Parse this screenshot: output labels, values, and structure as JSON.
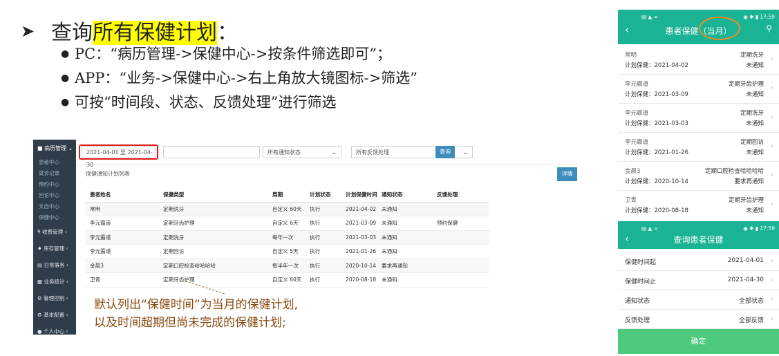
{
  "slide": {
    "heading_prefix": "查询",
    "heading_highlight": "所有保健计划",
    "heading_suffix": "：",
    "bullets": [
      "PC：“病历管理->保健中心->按条件筛选即可”；",
      "APP：“业务->保健中心->右上角放大镜图标->筛选”",
      "可按“时间段、状态、反馈处理”进行筛选"
    ],
    "note_lines": [
      "默认列出“保健时间”为当月的保健计划,",
      "以及时间超期但尚未完成的保健计划;"
    ],
    "highlight_color": "#ffff00"
  },
  "desktop": {
    "sidebar": {
      "top": "病历管理",
      "subitems": [
        "患者中心",
        "就诊记录",
        "预约中心",
        "回访中心",
        "文齿中心",
        "保健中心"
      ],
      "menus": [
        "收费管理",
        "库存管理",
        "日常事务",
        "业务统计",
        "管理控制",
        "基本配置",
        "个人中心"
      ]
    },
    "filters": {
      "date_range": "2021-04-01 至 2021-04-30",
      "notify_status": "所有通知状态",
      "feedback": "所有反馈处理",
      "query_label": "查询"
    },
    "list_title": "保健通知计划列表",
    "detail_label": "详情",
    "table": {
      "headers": [
        "患者姓名",
        "保健类型",
        "周期",
        "计划状态",
        "计划保健时间",
        "通知状态",
        "反馈处理"
      ],
      "rows": [
        [
          "常明",
          "定期洗牙",
          "自定义 60天",
          "执行",
          "2021-04-02",
          "未通知",
          ""
        ],
        [
          "李元霸道",
          "定期牙齿护理",
          "自定义 6天",
          "执行",
          "2021-03-09",
          "未通知",
          "预约保健"
        ],
        [
          "李元霸道",
          "定期洗牙",
          "每年一次",
          "执行",
          "2021-03-03",
          "未通知",
          ""
        ],
        [
          "李元霸道",
          "定期回访",
          "自定义 5天",
          "执行",
          "2021-01-26",
          "未通知",
          ""
        ],
        [
          "金晨3",
          "定期口腔检查哈哈哈哈",
          "每半年一次",
          "执行",
          "2020-10-14",
          "要求再通知",
          ""
        ],
        [
          "卫青",
          "定期牙齿护理",
          "自定义 60天",
          "执行",
          "2020-08-18",
          "未通知",
          ""
        ]
      ]
    },
    "accent": "#3c8dbc",
    "highlight_box_color": "#e0201a"
  },
  "phone_list": {
    "status_time": "17:59",
    "title": "患者保健（当月）",
    "plan_prefix": "计划保健：",
    "items": [
      {
        "name": "常明",
        "date": "2021-04-02",
        "type": "定期洗牙",
        "status": "未通知"
      },
      {
        "name": "李元霸道",
        "date": "2021-03-09",
        "type": "定期牙齿护理",
        "status": "未通知"
      },
      {
        "name": "李元霸道",
        "date": "2021-03-03",
        "type": "定期洗牙",
        "status": "未通知"
      },
      {
        "name": "李元霸道",
        "date": "2021-01-26",
        "type": "定期回访",
        "status": "未通知"
      },
      {
        "name": "金晨3",
        "date": "2020-10-14",
        "type": "定期口腔检查哈哈哈哈",
        "status": "要求再通知"
      },
      {
        "name": "卫青",
        "date": "2020-08-18",
        "type": "定期牙齿护理",
        "status": "未通知"
      }
    ],
    "bar_color": "#1ab394",
    "circle_color": "#f08a2a"
  },
  "phone_filter": {
    "status_time": "17:59",
    "title": "查询患者保健",
    "rows": [
      {
        "label": "保健时间起",
        "value": "2021-04-01"
      },
      {
        "label": "保健时间止",
        "value": "2021-04-30"
      },
      {
        "label": "通知状态",
        "value": "全部状态"
      },
      {
        "label": "反馈处理",
        "value": "全部反馈"
      }
    ],
    "confirm_label": "确定",
    "button_color": "#4cc97d"
  }
}
